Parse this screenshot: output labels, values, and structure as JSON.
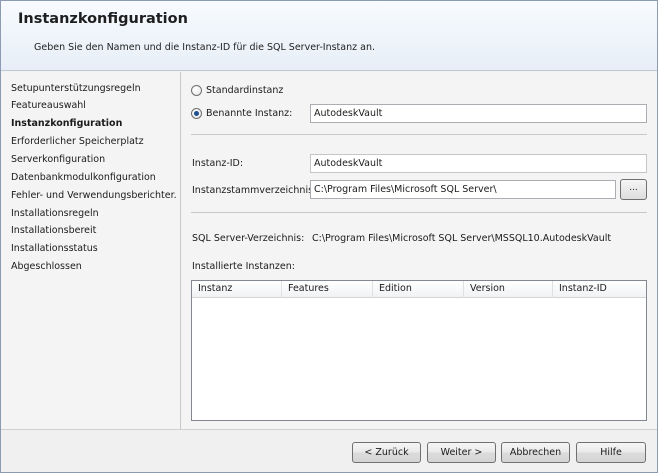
{
  "header": {
    "title": "Instanzkonfiguration",
    "subtitle": "Geben Sie den Namen und die Instanz-ID für die SQL Server-Instanz an."
  },
  "sidebar": {
    "items": [
      {
        "label": "Setupunterstützungsregeln",
        "active": false
      },
      {
        "label": "Featureauswahl",
        "active": false
      },
      {
        "label": "Instanzkonfiguration",
        "active": true
      },
      {
        "label": "Erforderlicher Speicherplatz",
        "active": false
      },
      {
        "label": "Serverkonfiguration",
        "active": false
      },
      {
        "label": "Datenbankmodulkonfiguration",
        "active": false
      },
      {
        "label": "Fehler- und Verwendungsberichter...",
        "active": false
      },
      {
        "label": "Installationsregeln",
        "active": false
      },
      {
        "label": "Installationsbereit",
        "active": false
      },
      {
        "label": "Installationsstatus",
        "active": false
      },
      {
        "label": "Abgeschlossen",
        "active": false
      }
    ]
  },
  "instance": {
    "default_label": "Standardinstanz",
    "default_checked": false,
    "named_label": "Benannte Instanz:",
    "named_checked": true,
    "named_value": "AutodeskVault",
    "id_label": "Instanz-ID:",
    "id_value": "AutodeskVault",
    "root_label": "Instanzstammverzeichnis:",
    "root_value": "C:\\Program Files\\Microsoft SQL Server\\",
    "browse_label": "...",
    "sqldir_label": "SQL Server-Verzeichnis:",
    "sqldir_value": "C:\\Program Files\\Microsoft SQL Server\\MSSQL10.AutodeskVault",
    "installed_label": "Installierte Instanzen:"
  },
  "table": {
    "columns": [
      "Instanz",
      "Features",
      "Edition",
      "Version",
      "Instanz-ID"
    ],
    "rows": []
  },
  "footer": {
    "back": "< Zurück",
    "next": "Weiter >",
    "cancel": "Abbrechen",
    "help": "Hilfe"
  },
  "colors": {
    "header_bg": "#e7eef7",
    "radio_dot": "#1d4f91"
  }
}
